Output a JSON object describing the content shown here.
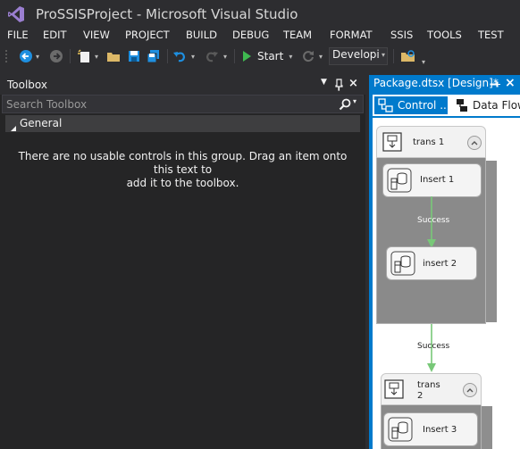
{
  "window": {
    "title": "ProSSISProject - Microsoft Visual Studio"
  },
  "menu": [
    "FILE",
    "EDIT",
    "VIEW",
    "PROJECT",
    "BUILD",
    "DEBUG",
    "TEAM",
    "FORMAT",
    "SSIS",
    "TOOLS",
    "TEST"
  ],
  "toolbar": {
    "start_label": "Start",
    "config_value": "Developi"
  },
  "toolbox": {
    "title": "Toolbox",
    "search_placeholder": "Search Toolbox",
    "group_label": "General",
    "empty_message_line1": "There are no usable controls in this group. Drag an item onto this text to",
    "empty_message_line2": "add it to the toolbox."
  },
  "designer": {
    "doc_tab": "Package.dtsx [Design]*",
    "tabs": {
      "control_flow": "Control ...",
      "data_flow": "Data Flow"
    },
    "containers": [
      {
        "label_line1": "trans 1",
        "label_line2": ""
      },
      {
        "label_line1": "trans",
        "label_line2": "2"
      }
    ],
    "tasks": [
      "Insert 1",
      "insert 2",
      "Insert 3"
    ],
    "constraints": [
      "Success",
      "Success"
    ]
  },
  "colors": {
    "accent": "#007acc",
    "success_arrow": "#78c878",
    "container_gray": "#8a8a8a"
  }
}
